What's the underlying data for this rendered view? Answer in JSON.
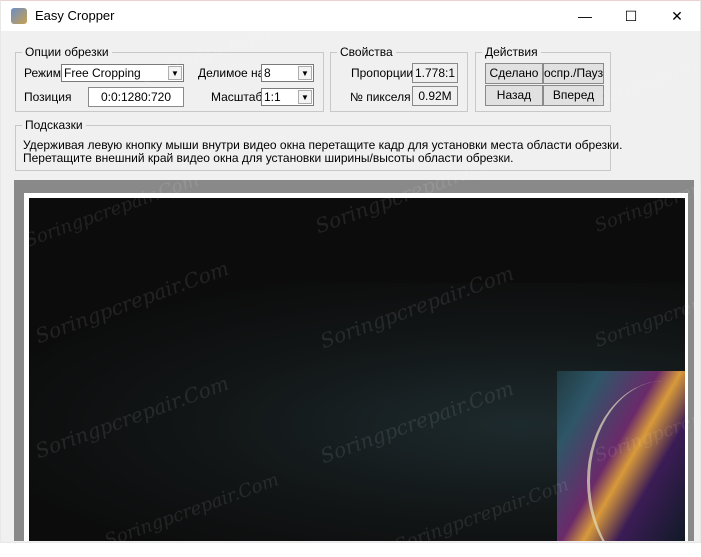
{
  "window": {
    "title": "Easy Cropper",
    "minimize_glyph": "—",
    "maximize_glyph": "☐",
    "close_glyph": "✕"
  },
  "crop_options": {
    "legend": "Опции обрезки",
    "mode_label": "Режим",
    "mode_value": "Free Cropping",
    "divisible_label": "Делимое на",
    "divisible_value": "8",
    "position_label": "Позиция",
    "position_value": "0:0:1280:720",
    "scale_label": "Масштаб",
    "scale_value": "1:1"
  },
  "properties": {
    "legend": "Свойства",
    "ratio_label": "Пропорции",
    "ratio_value": "1.778:1",
    "pixels_label": "№ пикселя",
    "pixels_value": "0.92M"
  },
  "actions": {
    "legend": "Действия",
    "done_label": "Сделано",
    "pause_label": "оспр./Пауз",
    "back_label": "Назад",
    "forward_label": "Вперед"
  },
  "hints": {
    "legend": "Подсказки",
    "line1": "Удерживая левую кнопку мыши внутри видео окна перетащите кадр для установки места области обрезки.",
    "line2": "Перетащите внешний край видео окна для установки ширины/высоты области обрезки."
  },
  "watermark_text": "Soringpcrepair.Com",
  "colors": {
    "video_bg": "#0c0c0c",
    "frame_gray": "#898989"
  }
}
